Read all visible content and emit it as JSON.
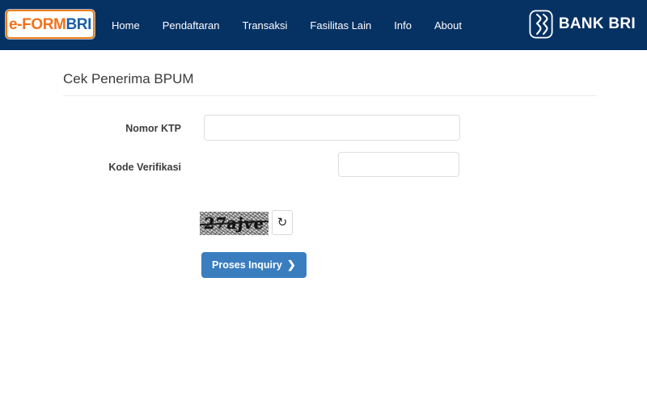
{
  "header": {
    "logo": {
      "primary_text": "e-FORM",
      "secondary_text": "BRI",
      "primary_color": "#f2711c",
      "secondary_color": "#1b5fa8",
      "border_color": "#f07f1a"
    },
    "background_color": "#063163",
    "nav_items": [
      {
        "label": "Home"
      },
      {
        "label": "Pendaftaran"
      },
      {
        "label": "Transaksi"
      },
      {
        "label": "Fasilitas Lain"
      },
      {
        "label": "Info"
      },
      {
        "label": "About"
      }
    ],
    "bank_logo": {
      "text": "BANK BRI",
      "icon": "bri-mark-icon"
    }
  },
  "main": {
    "page_title": "Cek Penerima BPUM",
    "form": {
      "ktp": {
        "label": "Nomor KTP",
        "value": "",
        "placeholder": ""
      },
      "kode_verifikasi": {
        "label": "Kode Verifikasi",
        "captcha_text": "27ajve",
        "refresh_icon": "refresh-icon",
        "refresh_glyph": "↻",
        "value": "",
        "placeholder": ""
      },
      "submit": {
        "label": "Proses Inquiry",
        "chevron": "❯",
        "color": "#3a7ebf"
      }
    }
  }
}
